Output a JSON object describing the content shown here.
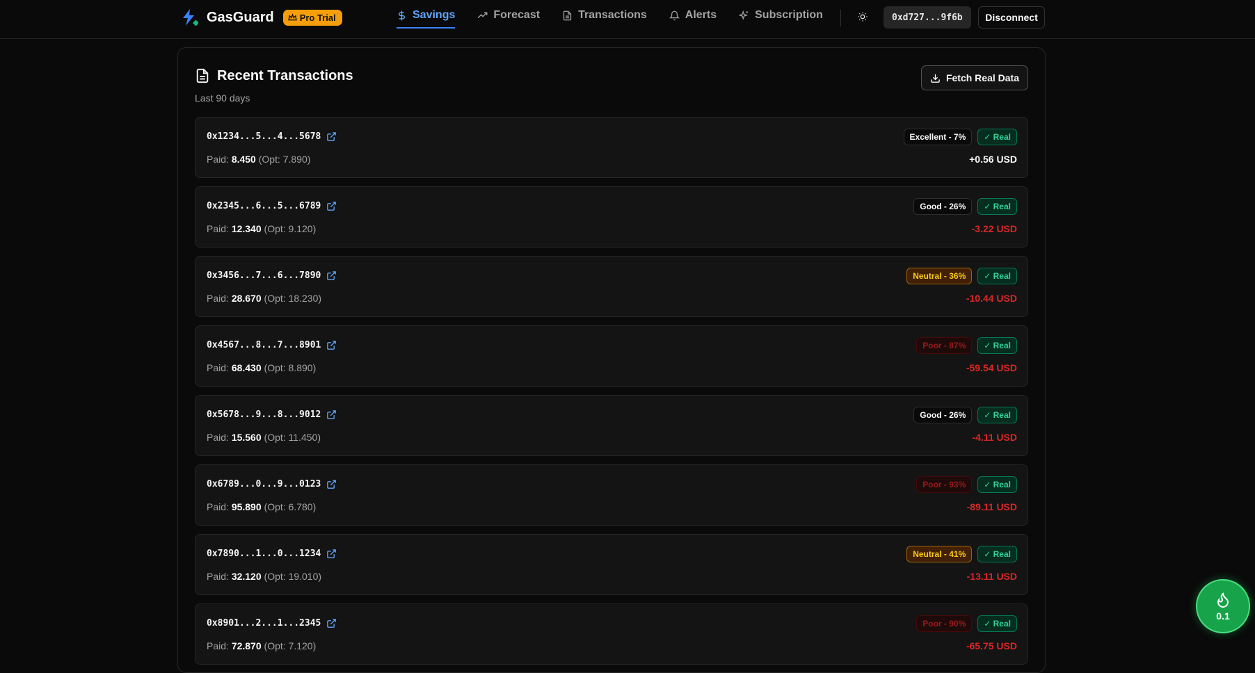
{
  "header": {
    "brand": "GasGuard",
    "pro_badge": "Pro Trial",
    "nav": [
      {
        "label": "Savings",
        "icon": "dollar-icon",
        "active": true
      },
      {
        "label": "Forecast",
        "icon": "trending-up-icon",
        "active": false
      },
      {
        "label": "Transactions",
        "icon": "file-text-icon",
        "active": false
      },
      {
        "label": "Alerts",
        "icon": "bell-icon",
        "active": false
      },
      {
        "label": "Subscription",
        "icon": "sparkles-icon",
        "active": false
      }
    ],
    "wallet": "0xd727...9f6b",
    "disconnect_label": "Disconnect"
  },
  "card": {
    "title": "Recent Transactions",
    "subtitle": "Last 90 days",
    "fetch_label": "Fetch Real Data"
  },
  "transactions": [
    {
      "hash": "0x1234...5...4...5678",
      "paid_label": "Paid:",
      "paid": "8.450",
      "opt": "(Opt: 7.890)",
      "rating": "Excellent - 7%",
      "rating_class": "excellent",
      "real": "✓ Real",
      "amount": "+0.56 USD",
      "amount_class": "pos"
    },
    {
      "hash": "0x2345...6...5...6789",
      "paid_label": "Paid:",
      "paid": "12.340",
      "opt": "(Opt: 9.120)",
      "rating": "Good - 26%",
      "rating_class": "good",
      "real": "✓ Real",
      "amount": "-3.22 USD",
      "amount_class": "neg"
    },
    {
      "hash": "0x3456...7...6...7890",
      "paid_label": "Paid:",
      "paid": "28.670",
      "opt": "(Opt: 18.230)",
      "rating": "Neutral - 36%",
      "rating_class": "neutral",
      "real": "✓ Real",
      "amount": "-10.44 USD",
      "amount_class": "neg"
    },
    {
      "hash": "0x4567...8...7...8901",
      "paid_label": "Paid:",
      "paid": "68.430",
      "opt": "(Opt: 8.890)",
      "rating": "Poor - 87%",
      "rating_class": "poor",
      "real": "✓ Real",
      "amount": "-59.54 USD",
      "amount_class": "neg"
    },
    {
      "hash": "0x5678...9...8...9012",
      "paid_label": "Paid:",
      "paid": "15.560",
      "opt": "(Opt: 11.450)",
      "rating": "Good - 26%",
      "rating_class": "good",
      "real": "✓ Real",
      "amount": "-4.11 USD",
      "amount_class": "neg"
    },
    {
      "hash": "0x6789...0...9...0123",
      "paid_label": "Paid:",
      "paid": "95.890",
      "opt": "(Opt: 6.780)",
      "rating": "Poor - 93%",
      "rating_class": "poor",
      "real": "✓ Real",
      "amount": "-89.11 USD",
      "amount_class": "neg"
    },
    {
      "hash": "0x7890...1...0...1234",
      "paid_label": "Paid:",
      "paid": "32.120",
      "opt": "(Opt: 19.010)",
      "rating": "Neutral - 41%",
      "rating_class": "neutral",
      "real": "✓ Real",
      "amount": "-13.11 USD",
      "amount_class": "neg"
    },
    {
      "hash": "0x8901...2...1...2345",
      "paid_label": "Paid:",
      "paid": "72.870",
      "opt": "(Opt: 7.120)",
      "rating": "Poor - 90%",
      "rating_class": "poor",
      "real": "✓ Real",
      "amount": "-65.75 USD",
      "amount_class": "neg"
    }
  ],
  "gas_widget": {
    "value": "0.1",
    "icon": "flame-icon"
  },
  "colors": {
    "accent": "#3b82f6",
    "pro": "#f59e0b",
    "negative": "#dc2626",
    "real": "#34d399",
    "gas": "#16a34a"
  }
}
